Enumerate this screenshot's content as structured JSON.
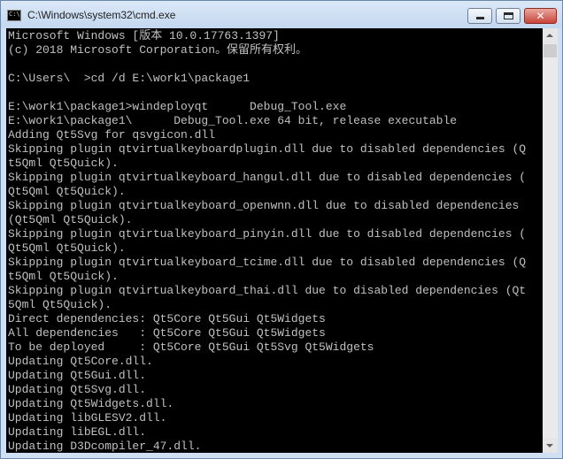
{
  "window": {
    "title": "C:\\Windows\\system32\\cmd.exe",
    "app_icon": "cmd-prompt-icon",
    "app_icon_glyph": "C:\\"
  },
  "caption_buttons": {
    "minimize_icon": "minimize-icon",
    "maximize_icon": "maximize-icon",
    "close_icon": "close-icon",
    "close_glyph": "✕"
  },
  "console": {
    "background": "#000000",
    "foreground": "#c0c0c0",
    "lines": [
      "Microsoft Windows [版本 10.0.17763.1397]",
      "(c) 2018 Microsoft Corporation。保留所有权利。",
      "",
      "C:\\Users\\  >cd /d E:\\work1\\package1",
      "",
      "E:\\work1\\package1>windeployqt      Debug_Tool.exe",
      "E:\\work1\\package1\\      Debug_Tool.exe 64 bit, release executable",
      "Adding Qt5Svg for qsvgicon.dll",
      "Skipping plugin qtvirtualkeyboardplugin.dll due to disabled dependencies (Q",
      "t5Qml Qt5Quick).",
      "Skipping plugin qtvirtualkeyboard_hangul.dll due to disabled dependencies (",
      "Qt5Qml Qt5Quick).",
      "Skipping plugin qtvirtualkeyboard_openwnn.dll due to disabled dependencies",
      "(Qt5Qml Qt5Quick).",
      "Skipping plugin qtvirtualkeyboard_pinyin.dll due to disabled dependencies (",
      "Qt5Qml Qt5Quick).",
      "Skipping plugin qtvirtualkeyboard_tcime.dll due to disabled dependencies (Q",
      "t5Qml Qt5Quick).",
      "Skipping plugin qtvirtualkeyboard_thai.dll due to disabled dependencies (Qt",
      "5Qml Qt5Quick).",
      "Direct dependencies: Qt5Core Qt5Gui Qt5Widgets",
      "All dependencies   : Qt5Core Qt5Gui Qt5Widgets",
      "To be deployed     : Qt5Core Qt5Gui Qt5Svg Qt5Widgets",
      "Updating Qt5Core.dll.",
      "Updating Qt5Gui.dll.",
      "Updating Qt5Svg.dll.",
      "Updating Qt5Widgets.dll.",
      "Updating libGLESV2.dll.",
      "Updating libEGL.dll.",
      "Updating D3Dcompiler_47.dll."
    ]
  },
  "scrollbar": {
    "up_icon": "scroll-up-arrow-icon",
    "down_icon": "scroll-down-arrow-icon"
  }
}
